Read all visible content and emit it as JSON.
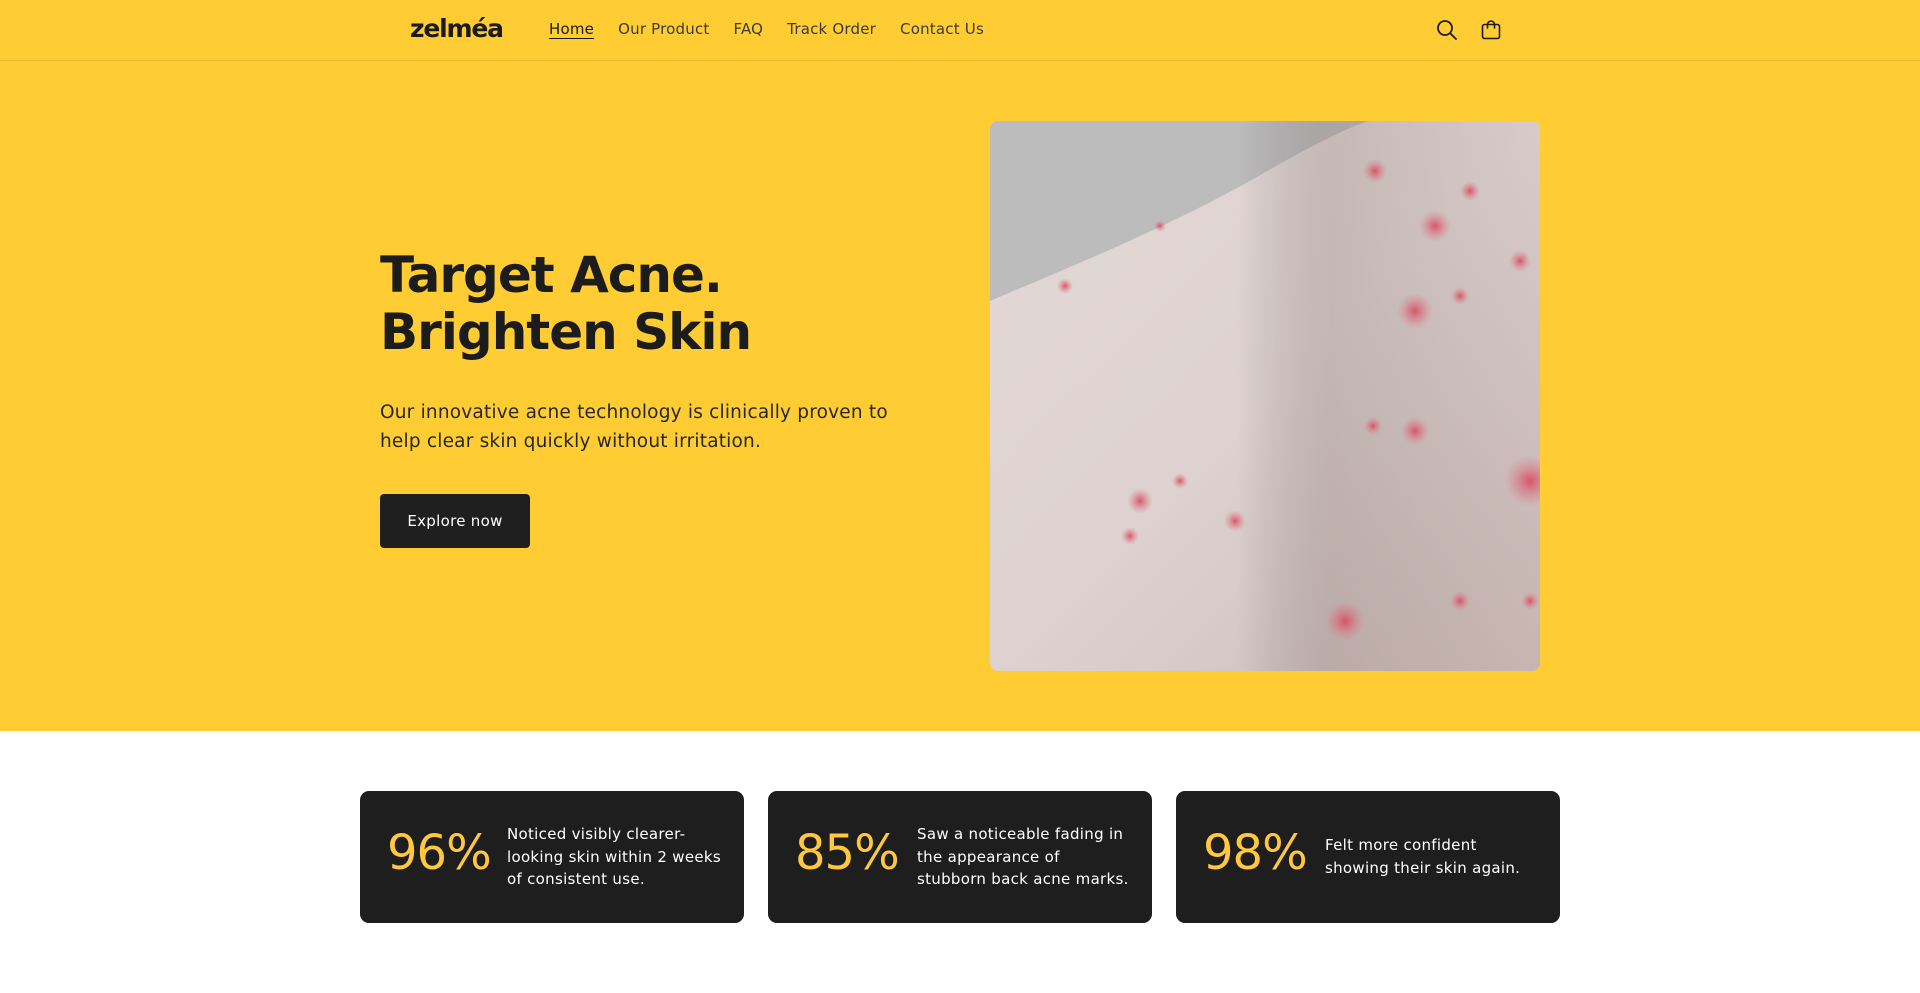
{
  "header": {
    "logo": "zelméa",
    "nav": [
      {
        "label": "Home",
        "active": true
      },
      {
        "label": "Our Product",
        "active": false
      },
      {
        "label": "FAQ",
        "active": false
      },
      {
        "label": "Track Order",
        "active": false
      },
      {
        "label": "Contact Us",
        "active": false
      }
    ],
    "icons": [
      "search-icon",
      "cart-icon"
    ]
  },
  "hero": {
    "title": "Target Acne. Brighten Skin",
    "subtitle": "Our innovative acne technology is clinically proven to help clear skin quickly without irritation.",
    "cta_label": "Explore now",
    "image_subject": "skin-with-acne"
  },
  "stats": [
    {
      "value": "96%",
      "text": "Noticed visibly clearer-looking skin within 2 weeks of consistent use."
    },
    {
      "value": "85%",
      "text": "Saw a noticeable fading in the appearance of stubborn back acne marks."
    },
    {
      "value": "98%",
      "text": "Felt more confident showing their skin again."
    }
  ],
  "colors": {
    "brand_yellow": "#ffcd33",
    "card_dark": "#1e1e1e",
    "stat_accent": "#ffc83d",
    "button_dark": "#1f1f1f"
  }
}
